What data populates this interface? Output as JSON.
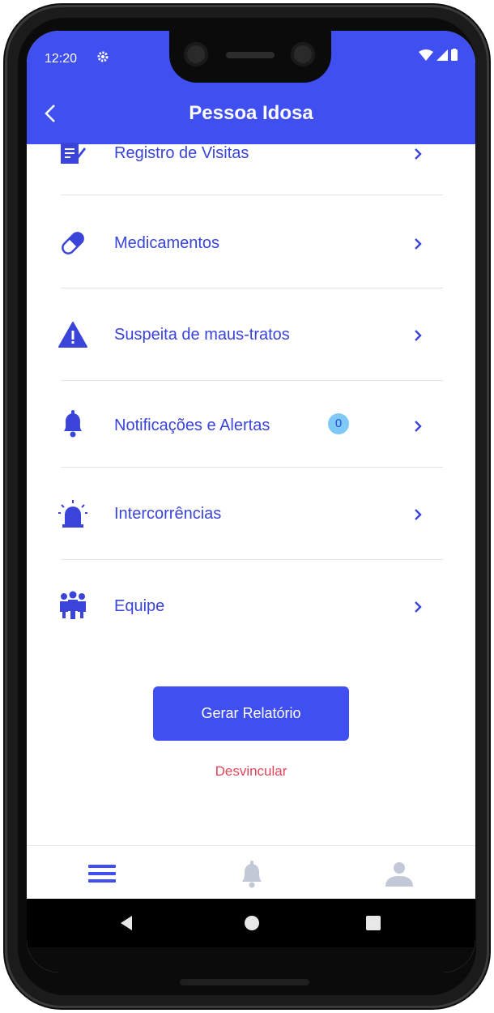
{
  "status_bar": {
    "time": "12:20"
  },
  "header": {
    "title": "Pessoa Idosa"
  },
  "menu": {
    "items": [
      {
        "label": "Registro de Visitas",
        "icon": "register-icon"
      },
      {
        "label": "Medicamentos",
        "icon": "pill-icon"
      },
      {
        "label": "Suspeita de maus-tratos",
        "icon": "warning-icon"
      },
      {
        "label": "Notificações e Alertas",
        "icon": "bell-icon",
        "badge": "0"
      },
      {
        "label": "Intercorrências",
        "icon": "siren-icon"
      },
      {
        "label": "Equipe",
        "icon": "team-icon"
      }
    ]
  },
  "actions": {
    "report_label": "Gerar Relatório",
    "unlink_label": "Desvincular"
  },
  "colors": {
    "primary": "#3f4ff0",
    "text": "#3a44d8",
    "danger": "#e0455a",
    "badge": "#7ec9f5",
    "tab_inactive": "#c3c8d6"
  }
}
